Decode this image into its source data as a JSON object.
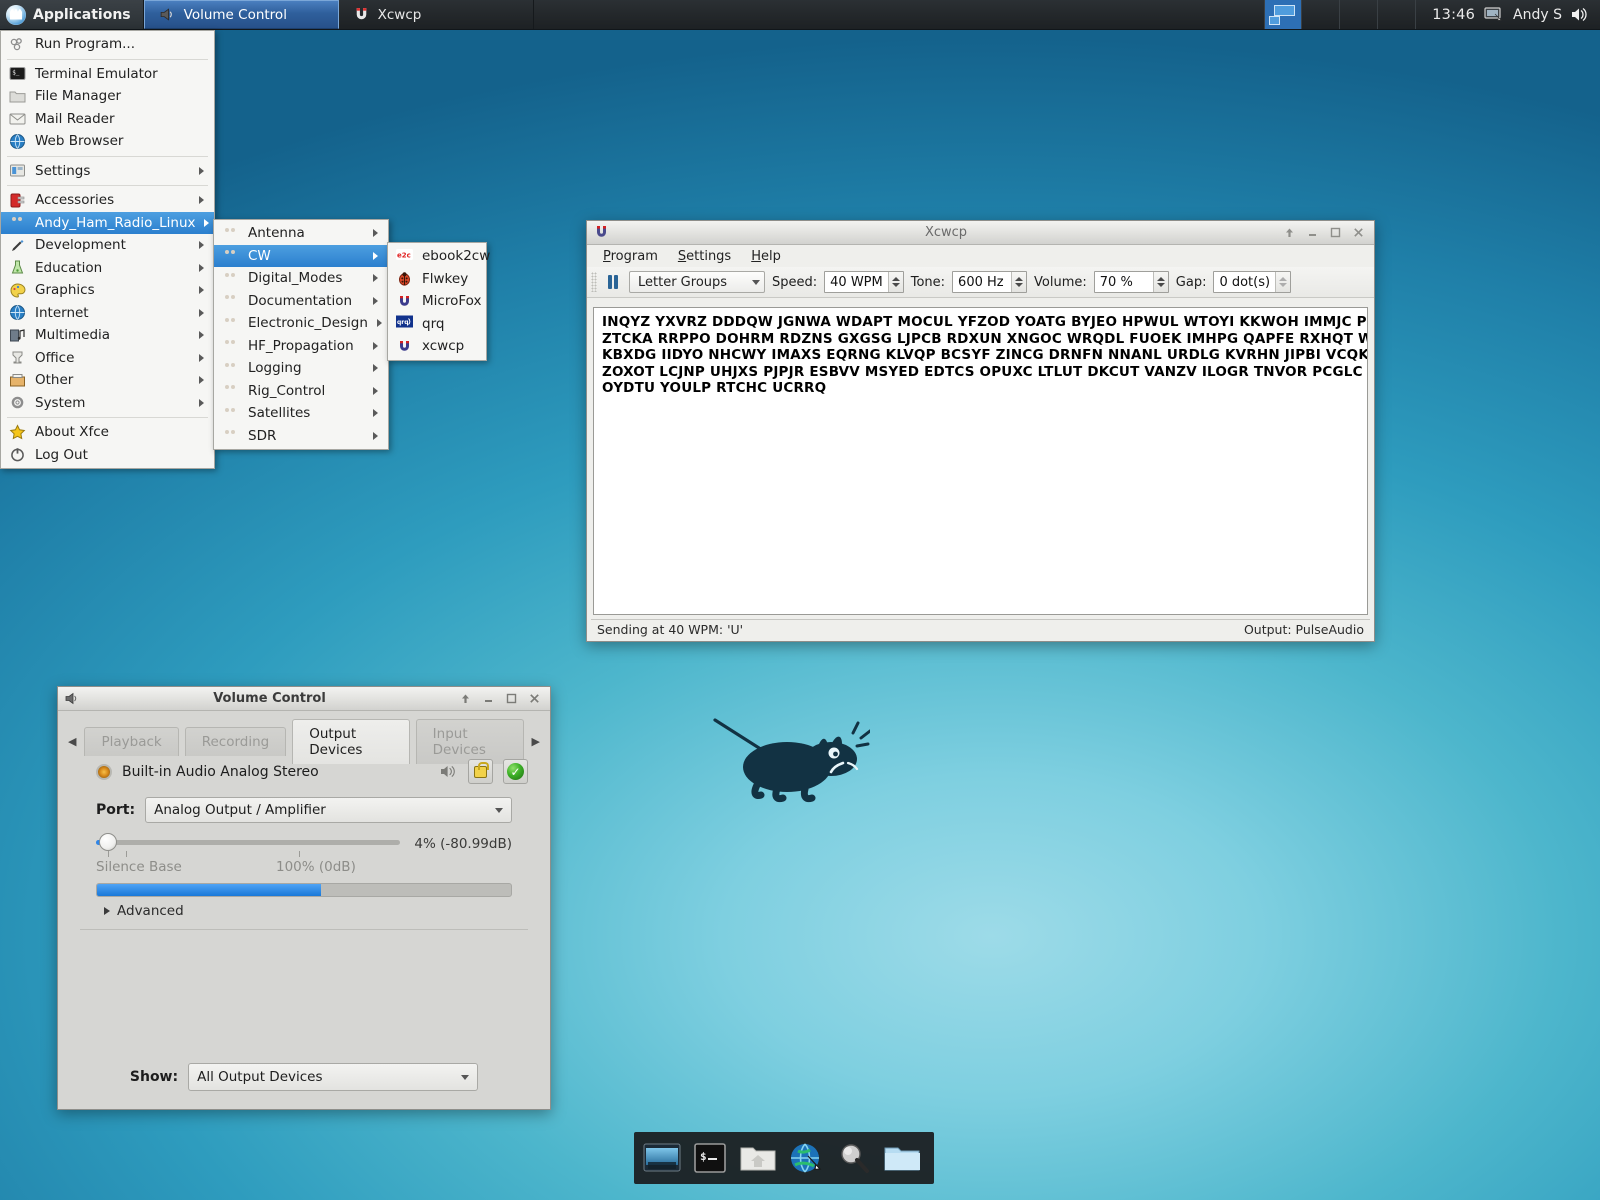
{
  "panel": {
    "apps_button": "Applications",
    "tasks": [
      {
        "label": "Volume Control",
        "icon": "speaker-icon",
        "active": true
      },
      {
        "label": "Xcwcp",
        "icon": "magnet-icon",
        "active": false
      }
    ],
    "clock": "13:46",
    "user": "Andy S",
    "tray_icons": [
      "display-icon",
      "volume-icon"
    ]
  },
  "app_menu": {
    "items": [
      {
        "label": "Run Program...",
        "icon": "run-icon",
        "submenu": false,
        "sep_after": true
      },
      {
        "label": "Terminal Emulator",
        "icon": "terminal-icon",
        "submenu": false
      },
      {
        "label": "File Manager",
        "icon": "folder-icon",
        "submenu": false
      },
      {
        "label": "Mail Reader",
        "icon": "mail-icon",
        "submenu": false
      },
      {
        "label": "Web Browser",
        "icon": "globe-icon",
        "submenu": false,
        "sep_after": true
      },
      {
        "label": "Settings",
        "icon": "settings-icon",
        "submenu": true,
        "sep_after": true
      },
      {
        "label": "Accessories",
        "icon": "accessories-icon",
        "submenu": true
      },
      {
        "label": "Andy_Ham_Radio_Linux",
        "icon": "ham-icon",
        "submenu": true,
        "selected": true
      },
      {
        "label": "Development",
        "icon": "development-icon",
        "submenu": true
      },
      {
        "label": "Education",
        "icon": "education-icon",
        "submenu": true
      },
      {
        "label": "Graphics",
        "icon": "graphics-icon",
        "submenu": true
      },
      {
        "label": "Internet",
        "icon": "internet-icon",
        "submenu": true
      },
      {
        "label": "Multimedia",
        "icon": "multimedia-icon",
        "submenu": true
      },
      {
        "label": "Office",
        "icon": "office-icon",
        "submenu": true
      },
      {
        "label": "Other",
        "icon": "other-icon",
        "submenu": true
      },
      {
        "label": "System",
        "icon": "system-icon",
        "submenu": true,
        "sep_after": true
      },
      {
        "label": "About Xfce",
        "icon": "star-icon",
        "submenu": false
      },
      {
        "label": "Log Out",
        "icon": "power-icon",
        "submenu": false
      }
    ]
  },
  "ham_submenu": {
    "items": [
      {
        "label": "Antenna",
        "icon": "ham-icon",
        "submenu": true
      },
      {
        "label": "CW",
        "icon": "ham-icon",
        "submenu": true,
        "selected": true
      },
      {
        "label": "Digital_Modes",
        "icon": "ham-icon",
        "submenu": true
      },
      {
        "label": "Documentation",
        "icon": "ham-icon",
        "submenu": true
      },
      {
        "label": "Electronic_Design",
        "icon": "ham-icon",
        "submenu": true
      },
      {
        "label": "HF_Propagation",
        "icon": "ham-icon",
        "submenu": true
      },
      {
        "label": "Logging",
        "icon": "ham-icon",
        "submenu": true
      },
      {
        "label": "Rig_Control",
        "icon": "ham-icon",
        "submenu": true
      },
      {
        "label": "Satellites",
        "icon": "ham-icon",
        "submenu": true
      },
      {
        "label": "SDR",
        "icon": "ham-icon",
        "submenu": true
      }
    ]
  },
  "cw_submenu": {
    "items": [
      {
        "label": "ebook2cw",
        "icon": "e2c-icon"
      },
      {
        "label": "Flwkey",
        "icon": "ladybug-icon"
      },
      {
        "label": "MicroFox",
        "icon": "magnet-icon"
      },
      {
        "label": "qrq",
        "icon": "qrq-icon"
      },
      {
        "label": "xcwcp",
        "icon": "magnet-icon"
      }
    ]
  },
  "xcwcp": {
    "title": "Xcwcp",
    "window_buttons": [
      "shade-icon",
      "minimize-icon",
      "maximize-icon",
      "close-icon"
    ],
    "menubar": [
      "Program",
      "Settings",
      "Help"
    ],
    "toolbar": {
      "pause_icon": "pause-icon",
      "mode_combo": "Letter Groups",
      "speed_label": "Speed:",
      "speed_value": "40 WPM",
      "tone_label": "Tone:",
      "tone_value": "600 Hz",
      "volume_label": "Volume:",
      "volume_value": "70 %",
      "gap_label": "Gap:",
      "gap_value": "0 dot(s)"
    },
    "text_lines": [
      "INQYZ YXVRZ DDDQW JGNWA WDAPT MOCUL YFZOD YOATG BYJEO HPWUL WTOYI KKWOH IMMJC PHRSC",
      "ZTCKA RRPPO DOHRM RDZNS GXGSG LJPCB RDXUN XNGOC WRQDL FUOEK IMHPG QAPFE RXHQT WPGED",
      "KBXDG IIDYO NHCWY IMAXS EQRNG KLVQP BCSYF ZINCG DRNFN NNANL URDLG KVRHN JIPBI VCQKG",
      "ZOXOT LCJNP UHJXS PJPJR ESBVV MSYED EDTCS OPUXC LTLUT DKCUT VANZV ILOGR TNVOR PCGLC IWVTT",
      "OYDTU YOULP RTCHC UCRRQ"
    ],
    "status_left": "Sending at 40 WPM: 'U'",
    "status_right": "Output: PulseAudio"
  },
  "volume_control": {
    "title": "Volume Control",
    "window_buttons": [
      "shade-icon",
      "minimize-icon",
      "maximize-icon",
      "close-icon"
    ],
    "tabs": [
      {
        "label": "Playback",
        "active": false
      },
      {
        "label": "Recording",
        "active": false
      },
      {
        "label": "Output Devices",
        "active": true
      },
      {
        "label": "Input Devices",
        "active": false
      }
    ],
    "device_name": "Built-in Audio Analog Stereo",
    "device_buttons": [
      "speaker-icon",
      "lock-icon",
      "default-check-icon"
    ],
    "port_label": "Port:",
    "port_value": "Analog Output / Amplifier",
    "volume_percent_text": "4% (-80.99dB)",
    "volume_percent": 4,
    "silence_base_label": "Silence Base",
    "full_scale_label": "100% (0dB)",
    "peak_level": 45,
    "advanced_label": "Advanced",
    "show_label": "Show:",
    "show_value": "All Output Devices"
  },
  "dock": {
    "items": [
      {
        "name": "show-desktop-icon",
        "label": "Show Desktop"
      },
      {
        "name": "terminal-icon",
        "label": "Terminal"
      },
      {
        "name": "file-manager-icon",
        "label": "File Manager"
      },
      {
        "name": "web-browser-icon",
        "label": "Web Browser"
      },
      {
        "name": "search-icon",
        "label": "Find"
      },
      {
        "name": "folder-icon",
        "label": "Folder"
      }
    ]
  },
  "colors": {
    "accent_blue": "#2f86e8",
    "panel_dark": "#24282b",
    "menu_highlight": "#2b7fce",
    "desktop_teal": "#45c3c6"
  }
}
